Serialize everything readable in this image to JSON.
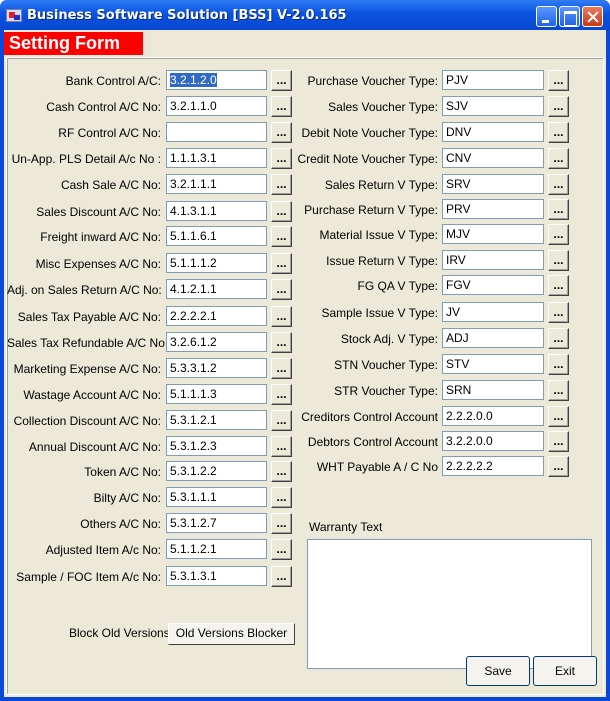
{
  "window": {
    "title": "Business Software Solution [BSS] V-2.0.165"
  },
  "form": {
    "header": "Setting Form",
    "left_fields": [
      {
        "label": "Bank Control A/C:",
        "value": "3.2.1.2.0",
        "selected": true
      },
      {
        "label": "Cash Control A/C No:",
        "value": "3.2.1.1.0"
      },
      {
        "label": "RF Control A/C No:",
        "value": ""
      },
      {
        "label": "Un-App. PLS Detail A/c No :",
        "value": "1.1.1.3.1"
      },
      {
        "label": "Cash Sale A/C No:",
        "value": "3.2.1.1.1"
      },
      {
        "label": "Sales Discount A/C No:",
        "value": "4.1.3.1.1"
      },
      {
        "label": "Freight inward A/C No:",
        "value": "5.1.1.6.1"
      },
      {
        "label": "Misc Expenses A/C No:",
        "value": "5.1.1.1.2"
      },
      {
        "label": "Adj. on Sales Return A/C No:",
        "value": "4.1.2.1.1"
      },
      {
        "label": "Sales Tax Payable A/C No:",
        "value": "2.2.2.2.1"
      },
      {
        "label": "Sales Tax Refundable A/C No:",
        "value": "3.2.6.1.2"
      },
      {
        "label": "Marketing Expense A/C No:",
        "value": "5.3.3.1.2"
      },
      {
        "label": "Wastage Account A/C No:",
        "value": "5.1.1.1.3"
      },
      {
        "label": "Collection Discount A/C No:",
        "value": "5.3.1.2.1"
      },
      {
        "label": "Annual Discount A/C No:",
        "value": "5.3.1.2.3"
      },
      {
        "label": "Token A/C No:",
        "value": "5.3.1.2.2"
      },
      {
        "label": "Bilty A/C No:",
        "value": "5.3.1.1.1"
      },
      {
        "label": "Others A/C No:",
        "value": "5.3.1.2.7"
      },
      {
        "label": "Adjusted Item A/c No:",
        "value": "5.1.1.2.1"
      },
      {
        "label": "Sample / FOC Item A/c No:",
        "value": "5.3.1.3.1"
      }
    ],
    "right_fields": [
      {
        "label": "Purchase Voucher Type:",
        "value": "PJV"
      },
      {
        "label": "Sales Voucher Type:",
        "value": "SJV"
      },
      {
        "label": "Debit Note Voucher Type:",
        "value": "DNV"
      },
      {
        "label": "Credit Note Voucher Type:",
        "value": "CNV"
      },
      {
        "label": "Sales Return V Type:",
        "value": "SRV"
      },
      {
        "label": "Purchase Return V Type:",
        "value": "PRV"
      },
      {
        "label": "Material Issue V Type:",
        "value": "MJV"
      },
      {
        "label": "Issue Return V Type:",
        "value": "IRV"
      },
      {
        "label": "FG QA V Type:",
        "value": "FGV"
      },
      {
        "label": "Sample Issue V Type:",
        "value": "JV"
      },
      {
        "label": "Stock Adj. V Type:",
        "value": "ADJ"
      },
      {
        "label": "STN Voucher Type:",
        "value": "STV"
      },
      {
        "label": "STR Voucher Type:",
        "value": "SRN"
      },
      {
        "label": "Creditors Control Account",
        "value": "2.2.2.0.0"
      },
      {
        "label": "Debtors Control Account",
        "value": "3.2.2.0.0"
      },
      {
        "label": "WHT Payable A / C No",
        "value": "2.2.2.2.2"
      }
    ],
    "browse_label": "...",
    "block_old_label": "Block Old Versions:",
    "block_old_button": "Old Versions Blocker",
    "warranty_label": "Warranty Text",
    "warranty_text": "",
    "save_label": "Save",
    "exit_label": "Exit"
  },
  "colors": {
    "titlebar": "#0b53e0",
    "header_bg": "#ff0000",
    "face": "#ece9d8",
    "selection": "#316ac5"
  }
}
